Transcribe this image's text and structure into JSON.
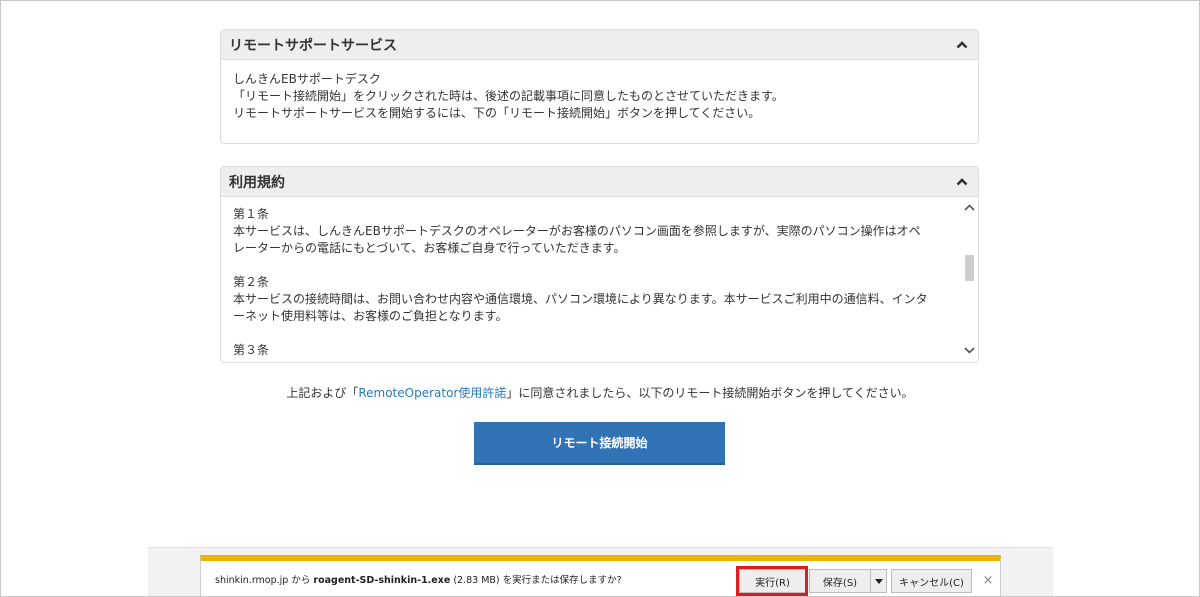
{
  "remote_panel": {
    "title": "リモートサポートサービス",
    "lines": [
      "しんきんEBサポートデスク",
      "「リモート接続開始」をクリックされた時は、後述の記載事項に同意したものとさせていただきます。",
      "リモートサポートサービスを開始するには、下の「リモート接続開始」ボタンを押してください。"
    ]
  },
  "terms_panel": {
    "title": "利用規約",
    "articles": [
      {
        "heading": "第１条",
        "text": "本サービスは、しんきんEBサポートデスクのオペレーターがお客様のパソコン画面を参照しますが、実際のパソコン操作はオペレーターからの電話にもとづいて、お客様ご自身で行っていただきます。"
      },
      {
        "heading": "第２条",
        "text": "本サービスの接続時間は、お問い合わせ内容や通信環境、パソコン環境により異なります。本サービスご利用中の通信料、インターネット使用料等は、お客様のご負担となります。"
      },
      {
        "heading": "第３条",
        "text": ""
      }
    ]
  },
  "agreement": {
    "prefix": "上記および「",
    "link": "RemoteOperator使用許諾",
    "suffix": "」に同意されましたら、以下のリモート接続開始ボタンを押してください。"
  },
  "start_button_label": "リモート接続開始",
  "download_bar": {
    "domain": "shinkin.rmop.jp",
    "from_text": " から ",
    "filename": "roagent-SD-shinkin-1.exe",
    "size": " (2.83 MB) ",
    "question": "を実行または保存しますか?",
    "run_label": "実行(R)",
    "save_label": "保存(S)",
    "cancel_label": "キャンセル(C)",
    "close_glyph": "×"
  },
  "colors": {
    "button_blue": "#3173b5",
    "link_blue": "#2a7ab8",
    "download_accent": "#f0b400",
    "highlight_red": "#e01b1b"
  }
}
